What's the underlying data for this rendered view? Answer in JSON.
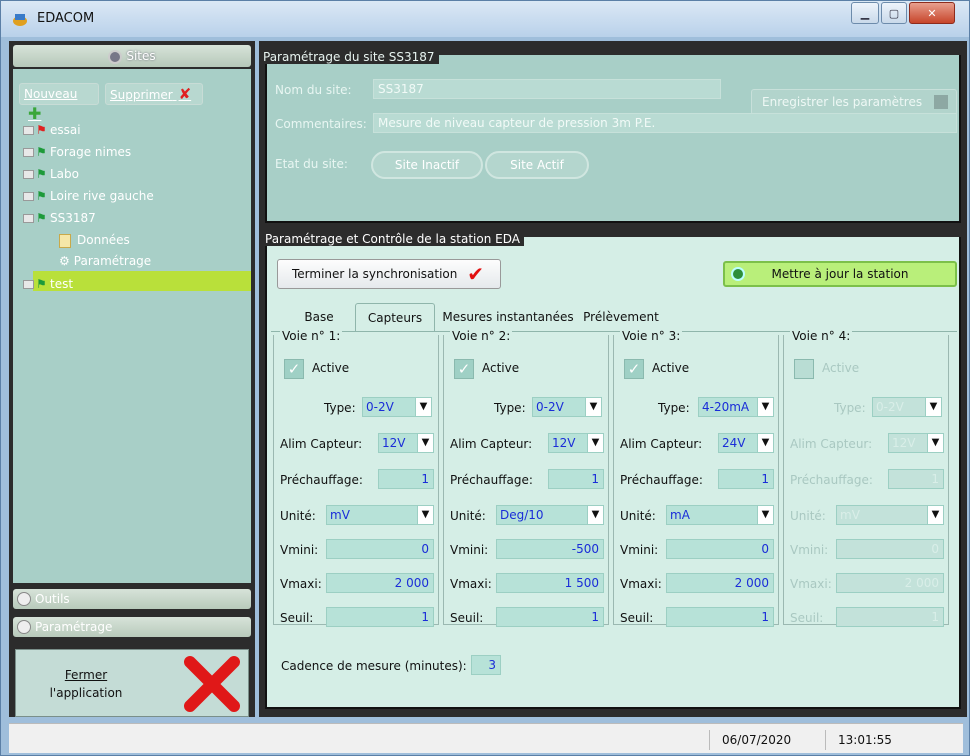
{
  "window": {
    "title": "EDACOM"
  },
  "sidebar": {
    "header": "Sites",
    "toolbar": {
      "new_label": "Nouveau",
      "delete_label": "Supprimer"
    },
    "tree": [
      {
        "label": "essai",
        "flag": "red"
      },
      {
        "label": "Forage nimes",
        "flag": "green"
      },
      {
        "label": "Labo",
        "flag": "green"
      },
      {
        "label": "Loire rive gauche",
        "flag": "green"
      },
      {
        "label": "SS3187",
        "flag": "green"
      },
      {
        "label": "Données",
        "child": true
      },
      {
        "label": "Paramétrage",
        "child": true,
        "selected": true
      },
      {
        "label": "test",
        "flag": "green"
      }
    ],
    "outils_label": "Outils",
    "parametrage_label": "Paramétrage",
    "close": {
      "line1": "Fermer",
      "line2": "l'application"
    }
  },
  "site_params": {
    "title": "Paramétrage du site SS3187",
    "name_label": "Nom du site:",
    "name_value": "SS3187",
    "comment_label": "Commentaires:",
    "comment_value": "Mesure de niveau capteur de pression 3m P.E.",
    "state_label": "Etat du site:",
    "inactive_label": "Site Inactif",
    "active_label": "Site Actif",
    "save_label": "Enregistrer les paramètres"
  },
  "station": {
    "title": "Paramétrage et Contrôle de la station EDA",
    "sync_label": "Terminer la synchronisation",
    "update_label": "Mettre à jour la station",
    "tabs": [
      "Base",
      "Capteurs",
      "Mesures instantanées",
      "Prélèvement"
    ],
    "active_tab": "Capteurs",
    "labels": {
      "active": "Active",
      "type": "Type:",
      "alim": "Alim Capteur:",
      "prechauffage": "Préchauffage:",
      "unite": "Unité:",
      "vmini": "Vmini:",
      "vmaxi": "Vmaxi:",
      "seuil": "Seuil:"
    },
    "voies": [
      {
        "title": "Voie n° 1:",
        "active": true,
        "type": "0-2V",
        "alim": "12V",
        "prechauffage": "1",
        "unite": "mV",
        "vmini": "0",
        "vmaxi": "2 000",
        "seuil": "1"
      },
      {
        "title": "Voie n° 2:",
        "active": true,
        "type": "0-2V",
        "alim": "12V",
        "prechauffage": "1",
        "unite": "Deg/10",
        "vmini": "-500",
        "vmaxi": "1 500",
        "seuil": "1"
      },
      {
        "title": "Voie n° 3:",
        "active": true,
        "type": "4-20mA",
        "alim": "24V",
        "prechauffage": "1",
        "unite": "mA",
        "vmini": "0",
        "vmaxi": "2 000",
        "seuil": "1"
      },
      {
        "title": "Voie n° 4:",
        "active": false,
        "type": "0-2V",
        "alim": "12V",
        "prechauffage": "1",
        "unite": "mV",
        "vmini": "0",
        "vmaxi": "2 000",
        "seuil": "1"
      }
    ],
    "cadence_label": "Cadence de mesure (minutes):",
    "cadence_value": "3"
  },
  "status": {
    "date": "06/07/2020",
    "time": "13:01:55"
  },
  "colors": {
    "accent": "#b9e03a",
    "delete": "#e02020",
    "sync_check": "#e21010"
  }
}
